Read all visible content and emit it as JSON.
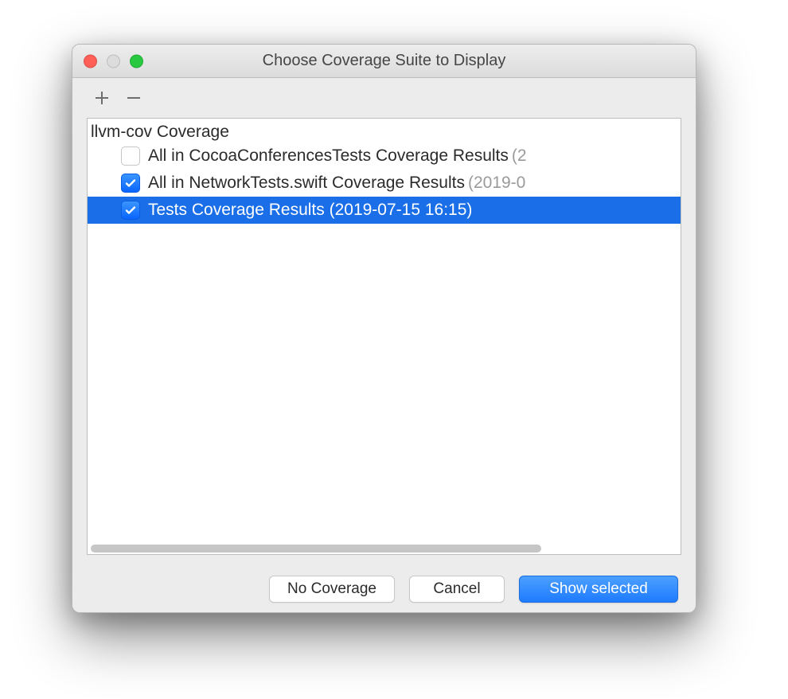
{
  "window": {
    "title": "Choose Coverage Suite to Display"
  },
  "toolbar": {
    "add_tooltip": "Add",
    "remove_tooltip": "Remove"
  },
  "list": {
    "group_label": "llvm-cov Coverage",
    "items": [
      {
        "checked": false,
        "selected": false,
        "label": "All in CocoaConferencesTests Coverage Results",
        "suffix": "(2"
      },
      {
        "checked": true,
        "selected": false,
        "label": "All in NetworkTests.swift Coverage Results",
        "suffix": "(2019-0"
      },
      {
        "checked": true,
        "selected": true,
        "label": "Tests Coverage Results (2019-07-15 16:15)",
        "suffix": ""
      }
    ]
  },
  "buttons": {
    "no_coverage": "No Coverage",
    "cancel": "Cancel",
    "show_selected": "Show selected"
  }
}
